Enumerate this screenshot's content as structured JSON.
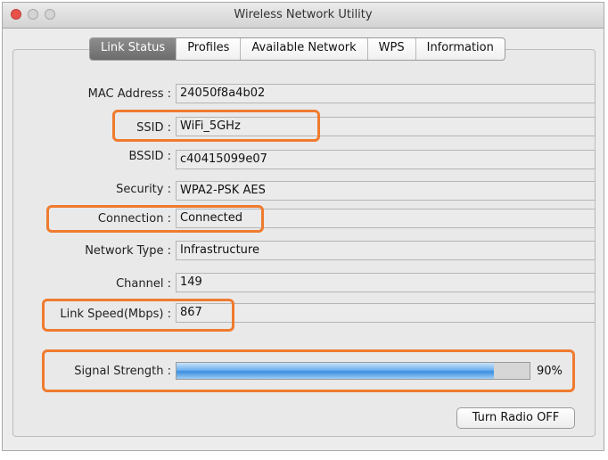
{
  "window": {
    "title": "Wireless Network Utility"
  },
  "tabs": [
    "Link Status",
    "Profiles",
    "Available Network",
    "WPS",
    "Information"
  ],
  "active_tab": "Link Status",
  "fields": {
    "mac_address": {
      "label": "MAC Address :",
      "value": "24050f8a4b02"
    },
    "ssid": {
      "label": "SSID :",
      "value": "WiFi_5GHz"
    },
    "bssid": {
      "label": "BSSID :",
      "value": "c40415099e07"
    },
    "security": {
      "label": "Security :",
      "value": "WPA2-PSK AES"
    },
    "connection": {
      "label": "Connection :",
      "value": "Connected"
    },
    "network_type": {
      "label": "Network Type :",
      "value": "Infrastructure"
    },
    "channel": {
      "label": "Channel :",
      "value": "149"
    },
    "link_speed": {
      "label": "Link Speed(Mbps) :",
      "value": "867"
    }
  },
  "signal": {
    "label": "Signal Strength :",
    "percent_text": "90%",
    "level": 0.9
  },
  "button": {
    "turn_radio_off": "Turn Radio OFF"
  },
  "colors": {
    "highlight": "#ef7b2f",
    "active_tab": "#7a7a7a",
    "progress": "#4a9be6"
  }
}
